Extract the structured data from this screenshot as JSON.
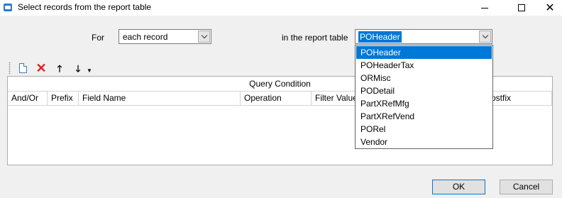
{
  "window": {
    "title": "Select records from the report table",
    "close_glyph": "✕"
  },
  "form": {
    "for_label": "For",
    "for_value": "each record",
    "table_label": "in the report table",
    "table_value": "POHeader"
  },
  "toolbar": {
    "icons": [
      "new-document-icon",
      "delete-icon",
      "move-up-icon",
      "move-down-icon",
      "overflow-icon"
    ],
    "glyphs": {
      "delete": "✕",
      "up": "🡑",
      "down": "🡓",
      "more": "▼"
    }
  },
  "grid": {
    "group_header": "Query Condition",
    "columns": [
      "And/Or",
      "Prefix",
      "Field Name",
      "Operation",
      "Filter Value",
      "Postfix"
    ],
    "rows": []
  },
  "dropdown": {
    "selected": "POHeader",
    "options": [
      "POHeader",
      "POHeaderTax",
      "ORMisc",
      "PODetail",
      "PartXRefMfg",
      "PartXRefVend",
      "PORel",
      "Vendor"
    ]
  },
  "buttons": {
    "ok": "OK",
    "cancel": "Cancel"
  },
  "colors": {
    "selection": "#0078d7",
    "delete_icon": "#e02020",
    "window_bg": "#f0f0f0"
  }
}
